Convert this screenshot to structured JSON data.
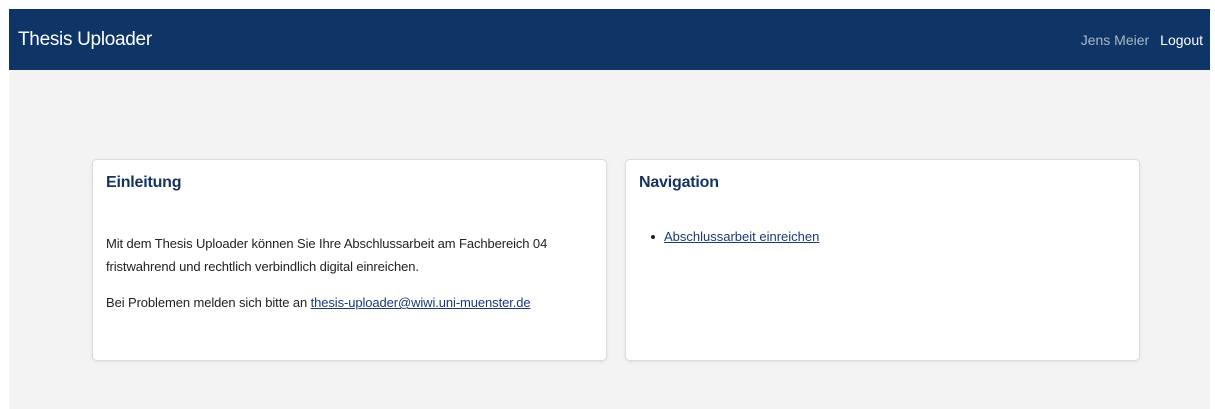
{
  "navbar": {
    "brand": "Thesis Uploader",
    "user_name": "Jens Meier",
    "logout_label": "Logout"
  },
  "intro_card": {
    "title": "Einleitung",
    "paragraph1_line1": "Mit dem Thesis Uploader können Sie Ihre Abschlussarbeit am Fachbereich 04",
    "paragraph1_line2": "fristwahrend und rechtlich verbindlich digital einreichen.",
    "paragraph2_prefix": "Bei Problemen melden sich bitte an ",
    "contact_email": "thesis-uploader@wiwi.uni-muenster.de"
  },
  "navigation_card": {
    "title": "Navigation",
    "items": [
      {
        "label": "Abschlussarbeit einreichen"
      }
    ]
  },
  "colors": {
    "navbar_bg": "#0f3567",
    "page_bg": "#f3f3f3",
    "title_color": "#15335f",
    "link_color": "#1a3a78"
  }
}
